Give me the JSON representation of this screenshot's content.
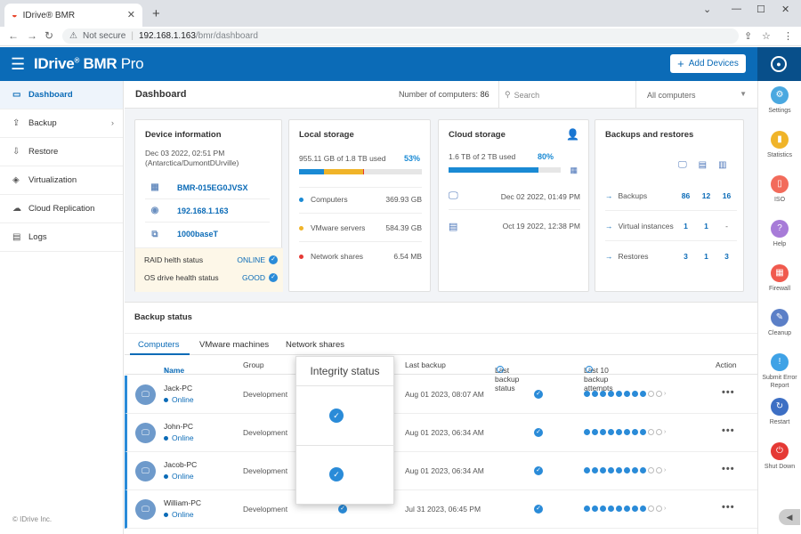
{
  "browser": {
    "tab_title": "IDrive® BMR",
    "favicon": "idrive-favicon",
    "not_secure": "Not secure",
    "url_host": "192.168.1.163",
    "url_path": "/bmr/dashboard"
  },
  "app": {
    "logo_brand": "IDrive",
    "logo_sup": "®",
    "logo_product": "BMR",
    "logo_edition": "Pro",
    "add_devices_label": "Add Devices",
    "copyright": "© IDrive Inc."
  },
  "sidebar": {
    "items": [
      {
        "label": "Dashboard",
        "icon": "monitor-icon"
      },
      {
        "label": "Backup",
        "icon": "backup-icon"
      },
      {
        "label": "Restore",
        "icon": "restore-icon"
      },
      {
        "label": "Virtualization",
        "icon": "layers-icon"
      },
      {
        "label": "Cloud Replication",
        "icon": "cloud-icon"
      },
      {
        "label": "Logs",
        "icon": "logs-icon"
      }
    ]
  },
  "rail": [
    {
      "label": "Settings",
      "color": "#4aa8e0",
      "icon": "gear-icon"
    },
    {
      "label": "Statistics",
      "color": "#f0b429",
      "icon": "stats-icon"
    },
    {
      "label": "ISO",
      "color": "#f26b5b",
      "icon": "iso-icon"
    },
    {
      "label": "Help",
      "color": "#a77bd8",
      "icon": "help-icon"
    },
    {
      "label": "Firewall",
      "color": "#f05a4e",
      "icon": "firewall-icon"
    },
    {
      "label": "Cleanup",
      "color": "#5b7fc7",
      "icon": "cleanup-icon"
    },
    {
      "label": "Submit Error Report",
      "color": "#3fa2e6",
      "icon": "warning-icon"
    },
    {
      "label": "Restart",
      "color": "#3d6fc4",
      "icon": "restart-icon"
    },
    {
      "label": "Shut Down",
      "color": "#e53935",
      "icon": "power-icon"
    }
  ],
  "dashboard": {
    "title": "Dashboard",
    "computers_label": "Number of computers:",
    "computers_count": "86",
    "search_placeholder": "Search",
    "filter_value": "All computers"
  },
  "device": {
    "title": "Device information",
    "date": "Dec 03 2022, 02:51 PM",
    "tz": "(Antarctica/DumontDUrville)",
    "serial": "BMR-015EG0JVSX",
    "ip": "192.168.1.163",
    "link": "1000baseT",
    "raid_label": "RAID helth status",
    "raid_value": "ONLINE",
    "os_label": "OS drive health status",
    "os_value": "GOOD"
  },
  "local": {
    "title": "Local storage",
    "used": "955.11 GB of 1.8 TB used",
    "pct": "53%",
    "rows": [
      {
        "label": "Computers",
        "value": "369.93 GB",
        "color": "#1a8ad4",
        "fraction": 0.2
      },
      {
        "label": "VMware servers",
        "value": "584.39 GB",
        "color": "#f0b429",
        "fraction": 0.32
      },
      {
        "label": "Network shares",
        "value": "6.54 MB",
        "color": "#e53935",
        "fraction": 0.01
      }
    ]
  },
  "cloud": {
    "title": "Cloud storage",
    "used": "1.6 TB of 2 TB used",
    "pct": "80%",
    "fraction": 0.8,
    "rows": [
      {
        "icon": "monitor-icon",
        "date": "Dec 02 2022, 01:49 PM"
      },
      {
        "icon": "server-icon",
        "date": "Oct 19 2022, 12:38 PM"
      }
    ]
  },
  "bkr": {
    "title": "Backups and restores",
    "rows": [
      {
        "label": "Backups",
        "a": "86",
        "b": "12",
        "c": "16"
      },
      {
        "label": "Virtual instances",
        "a": "1",
        "b": "1",
        "c": "-"
      },
      {
        "label": "Restores",
        "a": "3",
        "b": "1",
        "c": "3"
      }
    ]
  },
  "backup_status": {
    "title": "Backup status",
    "tabs": [
      "Computers",
      "VMware machines",
      "Network shares"
    ],
    "columns": {
      "name": "Name",
      "group": "Group",
      "last_backup": "Last backup",
      "last_status": "Last backup status",
      "attempts": "Last 10 backup attempts",
      "action": "Action"
    },
    "rows": [
      {
        "name": "Jack-PC",
        "status": "Online",
        "group": "Development",
        "last_backup": "Aug 01 2023, 08:07 AM",
        "success": 8
      },
      {
        "name": "John-PC",
        "status": "Online",
        "group": "Development",
        "last_backup": "Aug 01 2023, 06:34 AM",
        "success": 8
      },
      {
        "name": "Jacob-PC",
        "status": "Online",
        "group": "Development",
        "last_backup": "Aug 01 2023, 06:34 AM",
        "success": 8
      },
      {
        "name": "William-PC",
        "status": "Online",
        "group": "Development",
        "last_backup": "Jul 31 2023, 06:45 PM",
        "success": 8
      }
    ]
  },
  "popup": {
    "title": "Integrity status"
  }
}
